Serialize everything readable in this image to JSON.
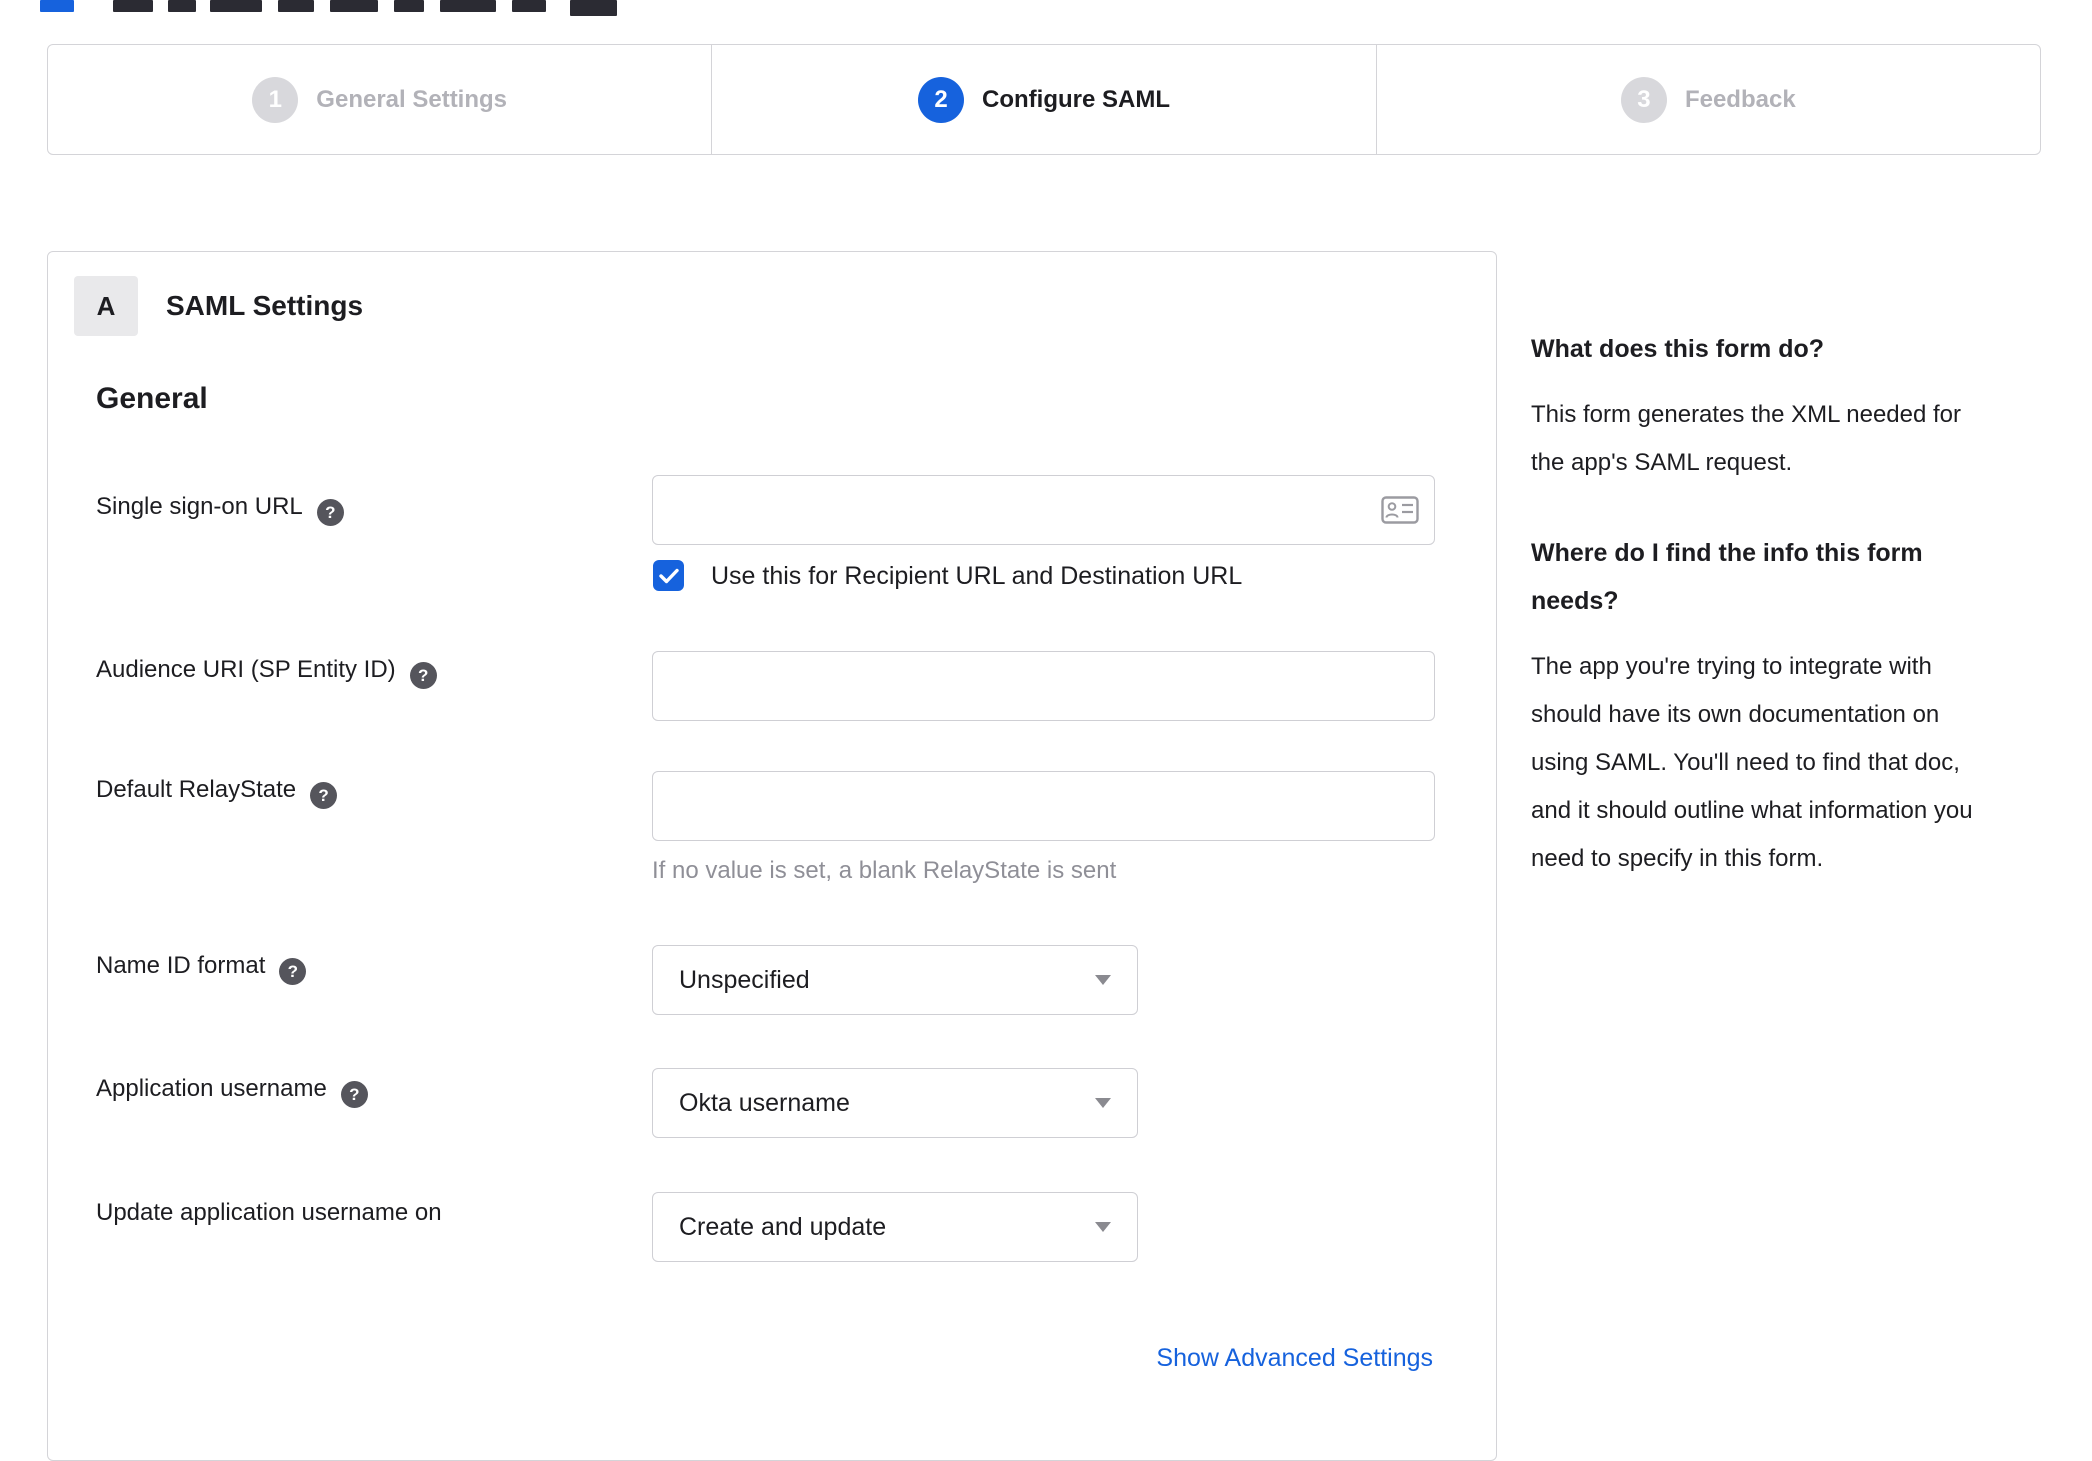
{
  "stepper": {
    "steps": [
      {
        "number": "1",
        "label": "General Settings",
        "state": "inactive"
      },
      {
        "number": "2",
        "label": "Configure SAML",
        "state": "active"
      },
      {
        "number": "3",
        "label": "Feedback",
        "state": "inactive"
      }
    ]
  },
  "panel": {
    "section_badge": "A",
    "section_title": "SAML Settings",
    "group_title": "General",
    "fields": {
      "sso_url": {
        "label": "Single sign-on URL",
        "value": ""
      },
      "sso_checkbox": {
        "label": "Use this for Recipient URL and Destination URL",
        "checked": true
      },
      "audience": {
        "label": "Audience URI (SP Entity ID)",
        "value": ""
      },
      "relay_state": {
        "label": "Default RelayState",
        "value": "",
        "hint": "If no value is set, a blank RelayState is sent"
      },
      "name_id": {
        "label": "Name ID format",
        "value": "Unspecified"
      },
      "app_username": {
        "label": "Application username",
        "value": "Okta username"
      },
      "update_username": {
        "label": "Update application username on",
        "value": "Create and update"
      }
    },
    "advanced_link": "Show Advanced Settings"
  },
  "help": {
    "q1_title": "What does this form do?",
    "q1_body": "This form generates the XML needed for the app's SAML request.",
    "q2_title": "Where do I find the info this form needs?",
    "q2_body": "The app you're trying to integrate with should have its own documentation on using SAML. You'll need to find that doc, and it should outline what information you need to specify in this form."
  },
  "colors": {
    "accent": "#1662dd",
    "inactive_gray": "#d8d8dc"
  }
}
